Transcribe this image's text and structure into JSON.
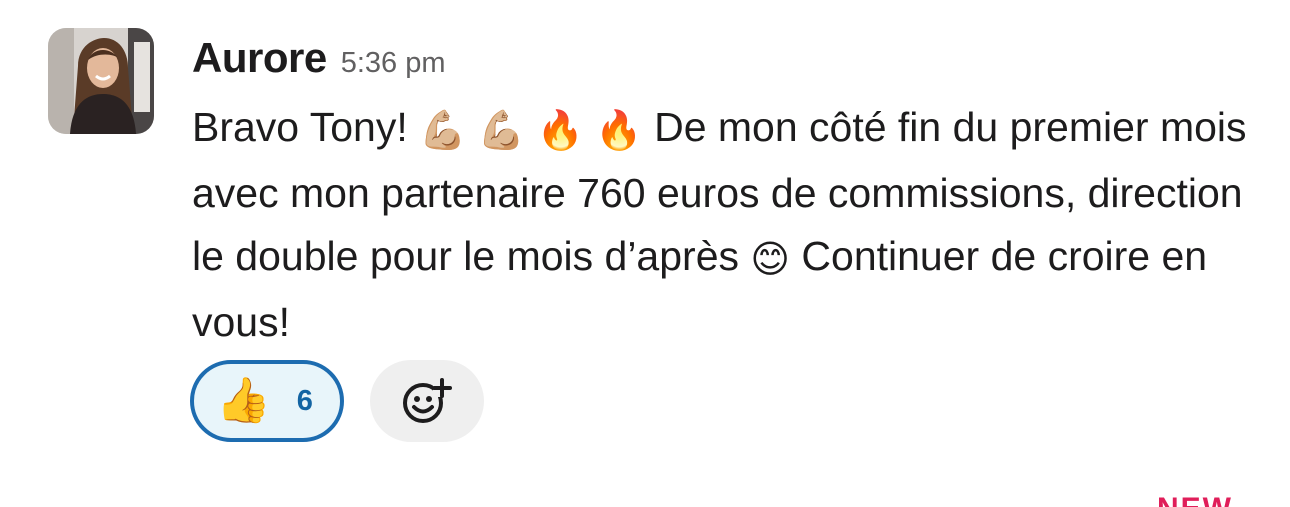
{
  "message": {
    "author": "Aurore",
    "timestamp": "5:36 pm",
    "text": {
      "part1": "Bravo Tony! ",
      "emoji_flex_1": "💪🏼",
      "emoji_flex_2": "💪🏼",
      "emoji_fire_1": "🔥",
      "emoji_fire_2": "🔥",
      "part2": " De mon côté fin du premier mois avec mon partenaire 760 euros de commissions, direction le double pour le mois d’après ",
      "emoji_smile": "😊",
      "part3": " Continuer de croire en vous!"
    }
  },
  "reactions": [
    {
      "emoji": "👍",
      "icon": "thumbs-up-icon",
      "count": "6",
      "selected": true
    }
  ],
  "add_reaction": {
    "icon": "add-reaction-icon"
  },
  "new_marker": {
    "label": "NEW"
  },
  "colors": {
    "reaction_border": "#1d6cb0",
    "reaction_bg": "#e8f5fa",
    "reaction_count": "#1264a3",
    "new_marker": "#e01e5a"
  }
}
